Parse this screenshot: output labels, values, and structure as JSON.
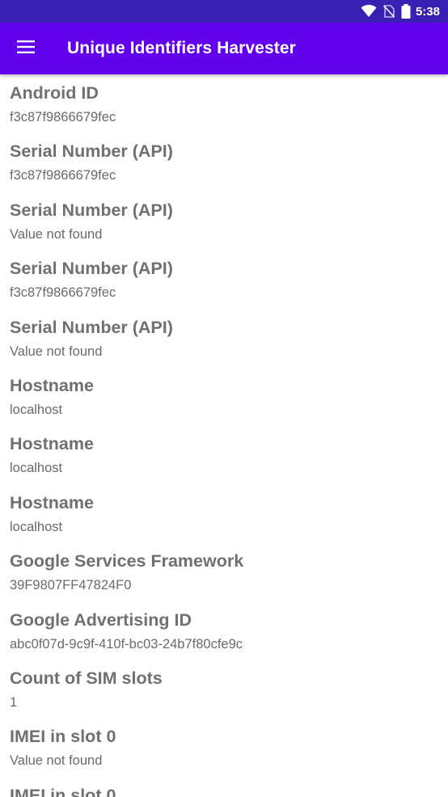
{
  "status_bar": {
    "time": "5:38",
    "icons": [
      "wifi-icon",
      "no-sim-icon",
      "battery-icon"
    ]
  },
  "app_bar": {
    "title": "Unique Identifiers Harvester",
    "menu_icon": "hamburger-menu-icon",
    "color": "#6200ee",
    "status_color": "#3a1fb3"
  },
  "identifiers": [
    {
      "label": "Android ID",
      "value": "f3c87f9866679fec"
    },
    {
      "label": "Serial Number (API)",
      "value": "f3c87f9866679fec"
    },
    {
      "label": "Serial Number (API)",
      "value": "Value not found"
    },
    {
      "label": "Serial Number (API)",
      "value": "f3c87f9866679fec"
    },
    {
      "label": "Serial Number (API)",
      "value": "Value not found"
    },
    {
      "label": "Hostname",
      "value": "localhost"
    },
    {
      "label": "Hostname",
      "value": "localhost"
    },
    {
      "label": "Hostname",
      "value": "localhost"
    },
    {
      "label": "Google Services Framework",
      "value": "39F9807FF47824F0"
    },
    {
      "label": "Google Advertising ID",
      "value": "abc0f07d-9c9f-410f-bc03-24b7f80cfe9c"
    },
    {
      "label": "Count of SIM slots",
      "value": "1"
    },
    {
      "label": "IMEI in slot 0",
      "value": "Value not found"
    },
    {
      "label": "IMEI in slot 0",
      "value": ""
    }
  ]
}
